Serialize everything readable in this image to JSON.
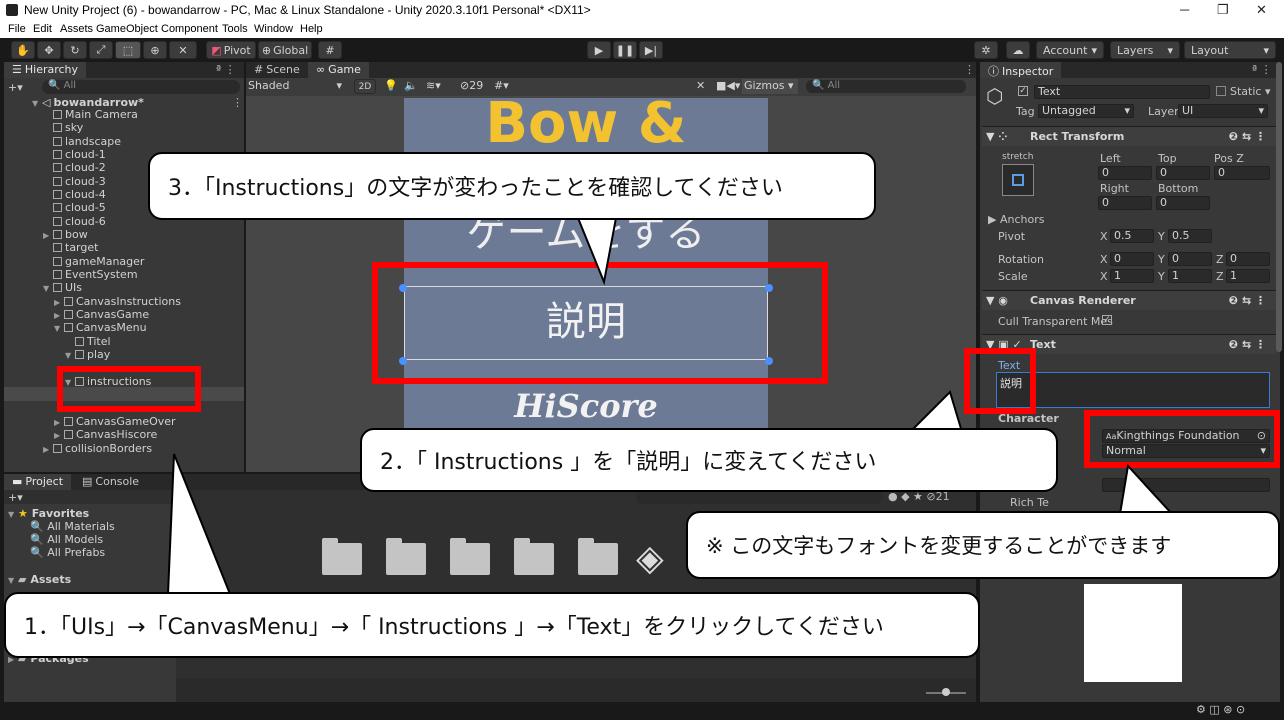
{
  "window": {
    "title": "New Unity Project (6) - bowandarrow - PC, Mac & Linux Standalone - Unity 2020.3.10f1 Personal* <DX11>",
    "minimize": "─",
    "maximize": "❐",
    "close": "✕"
  },
  "menu": [
    "File",
    "Edit",
    "Assets",
    "GameObject",
    "Component",
    "Tools",
    "Window",
    "Help"
  ],
  "toolbar": {
    "pivot": "Pivot",
    "global": "Global",
    "account": "Account",
    "layers": "Layers",
    "layout": "Layout"
  },
  "hierarchy": {
    "tab": "Hierarchy",
    "search_placeholder": "All",
    "scene": "bowandarrow*",
    "items": [
      {
        "label": "Main Camera"
      },
      {
        "label": "sky"
      },
      {
        "label": "landscape"
      },
      {
        "label": "cloud-1"
      },
      {
        "label": "cloud-2"
      },
      {
        "label": "cloud-3"
      },
      {
        "label": "cloud-4"
      },
      {
        "label": "cloud-5"
      },
      {
        "label": "cloud-6"
      },
      {
        "label": "bow"
      },
      {
        "label": "target"
      },
      {
        "label": "gameManager"
      },
      {
        "label": "EventSystem"
      },
      {
        "label": "UIs"
      },
      {
        "label": "CanvasInstructions"
      },
      {
        "label": "CanvasGame"
      },
      {
        "label": "CanvasMenu"
      },
      {
        "label": "Titel"
      },
      {
        "label": "play"
      },
      {
        "label": "instructions"
      },
      {
        "label": "Text"
      },
      {
        "label": "CanvasGameOver"
      },
      {
        "label": "CanvasHiscore"
      },
      {
        "label": "collisionBorders"
      }
    ]
  },
  "scene_view": {
    "tab_scene": "Scene",
    "tab_game": "Game",
    "shading": "Shaded",
    "mode2d": "2D",
    "hidden_count": "29",
    "gizmos": "Gizmos",
    "search_placeholder": "All",
    "game_title": "Bow & Arrow",
    "button_play_partial": "ゲームをする",
    "button_instructions": "説明",
    "button_hiscore": "HiScore"
  },
  "project": {
    "tab_project": "Project",
    "tab_console": "Console",
    "favorites": "Favorites",
    "fav_items": [
      "All Materials",
      "All Models",
      "All Prefabs"
    ],
    "assets": "Assets",
    "packages": "Packages",
    "count": "21"
  },
  "inspector": {
    "tab": "Inspector",
    "object_name": "Text",
    "static": "Static",
    "tag_label": "Tag",
    "tag_value": "Untagged",
    "layer_label": "Layer",
    "layer_value": "UI",
    "rect_transform": "Rect Transform",
    "stretch": "stretch",
    "left": "Left",
    "top": "Top",
    "posz": "Pos Z",
    "right": "Right",
    "bottom": "Bottom",
    "left_v": "0",
    "top_v": "0",
    "posz_v": "0",
    "right_v": "0",
    "bottom_v": "0",
    "anchors": "Anchors",
    "pivot": "Pivot",
    "pivot_x": "0.5",
    "pivot_y": "0.5",
    "rotation": "Rotation",
    "rot_x": "0",
    "rot_y": "0",
    "rot_z": "0",
    "scale": "Scale",
    "scale_x": "1",
    "scale_y": "1",
    "scale_z": "1",
    "canvas_renderer": "Canvas Renderer",
    "cull": "Cull Transparent Mes",
    "text_component": "Text",
    "text_label": "Text",
    "text_value": "説明",
    "character": "Character",
    "font": "Kingthings Foundation",
    "font_style": "Normal",
    "line_spacing_partial": "ng",
    "rich_text_partial": "Rich Te"
  },
  "annotations": {
    "step1": "1．「UIs」→「CanvasMenu」→「 Instructions 」→「Text」をクリックしてください",
    "step2": "2．「 Instructions 」を「説明」に変えてください",
    "step3": "3．「Instructions」の文字が変わったことを確認してください",
    "note": "※ この文字もフォントを変更することができます"
  },
  "colors": {
    "red": "#ff0000",
    "game_bg": "#6d7a96",
    "title_yellow": "#f2c230",
    "panel": "#383838"
  }
}
